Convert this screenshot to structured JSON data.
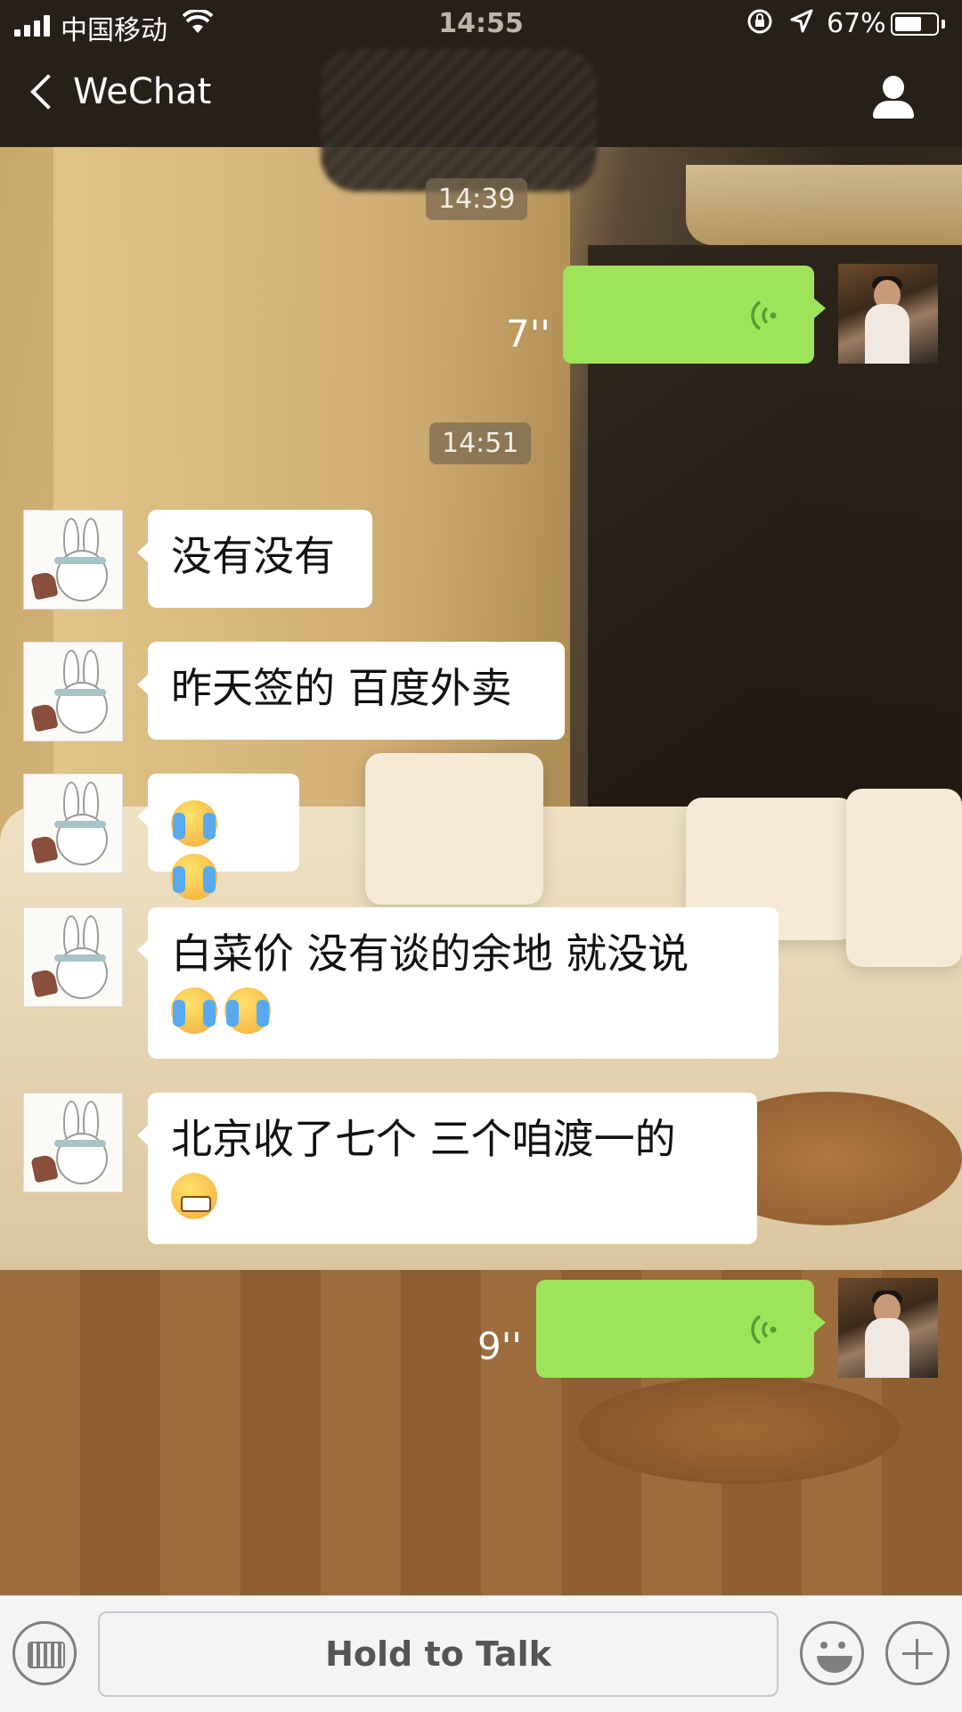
{
  "status_bar": {
    "carrier": "中国移动",
    "time": "14:55",
    "battery": "67%",
    "battery_level": 0.67
  },
  "nav": {
    "back_label": "WeChat"
  },
  "timestamps": [
    "14:39",
    "14:51"
  ],
  "messages": [
    {
      "type": "voice",
      "side": "out",
      "duration": "7''"
    },
    {
      "type": "text",
      "side": "in",
      "text": "没有没有"
    },
    {
      "type": "text",
      "side": "in",
      "text": "昨天签的 百度外卖"
    },
    {
      "type": "emoji",
      "side": "in",
      "emojis": [
        "loudly-crying-emoji",
        "loudly-crying-emoji"
      ]
    },
    {
      "type": "text",
      "side": "in",
      "text": "白菜价  没有谈的余地  就没说",
      "emojis": [
        "loudly-crying-emoji",
        "loudly-crying-emoji"
      ]
    },
    {
      "type": "text",
      "side": "in",
      "text": "北京收了七个  三个咱渡一的",
      "emojis": [
        "grimacing-emoji"
      ]
    },
    {
      "type": "voice",
      "side": "out",
      "duration": "9''"
    }
  ],
  "input_bar": {
    "hold_to_talk": "Hold to Talk"
  },
  "colors": {
    "voice_bubble": "#9de45b",
    "bar_dark": "#262019"
  }
}
